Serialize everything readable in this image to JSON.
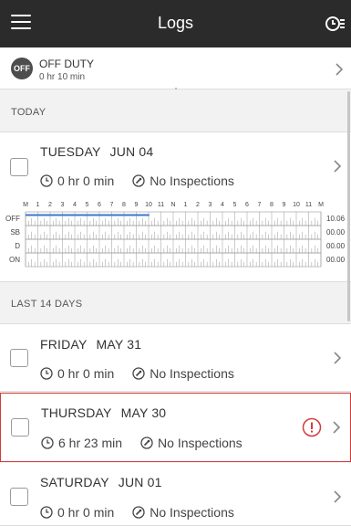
{
  "header": {
    "title": "Logs",
    "menu_icon": "hamburger-menu-icon",
    "status_icon": "duty-status-icon"
  },
  "current_status": {
    "badge": "OFF",
    "label": "OFF DUTY",
    "duration": "0 hr 10 min"
  },
  "sections": {
    "today": "TODAY",
    "last14": "LAST 14 DAYS"
  },
  "today": {
    "day": "TUESDAY",
    "date": "JUN 04",
    "hours": "0 hr 0 min",
    "inspections": "No Inspections",
    "graph": {
      "hour_labels": [
        "M",
        "1",
        "2",
        "3",
        "4",
        "5",
        "6",
        "7",
        "8",
        "9",
        "10",
        "11",
        "N",
        "1",
        "2",
        "3",
        "4",
        "5",
        "6",
        "7",
        "8",
        "9",
        "10",
        "11",
        "M"
      ],
      "rows": [
        {
          "label": "OFF",
          "total": "10.06"
        },
        {
          "label": "SB",
          "total": "00.00"
        },
        {
          "label": "D",
          "total": "00.00"
        },
        {
          "label": "ON",
          "total": "00.00"
        }
      ],
      "off_duty_segment_hours": [
        0,
        10.06
      ],
      "line_color": "#3a78c9"
    }
  },
  "logs": [
    {
      "day": "FRIDAY",
      "date": "MAY 31",
      "hours": "0 hr 0 min",
      "inspections": "No Inspections",
      "violation": false
    },
    {
      "day": "THURSDAY",
      "date": "MAY 30",
      "hours": "6 hr 23 min",
      "inspections": "No Inspections",
      "violation": true
    },
    {
      "day": "SATURDAY",
      "date": "JUN 01",
      "hours": "0 hr 0 min",
      "inspections": "No Inspections",
      "violation": false
    }
  ],
  "colors": {
    "appbar": "#2b2b2b",
    "violation": "#d23b3b",
    "graph_line": "#3a78c9"
  }
}
